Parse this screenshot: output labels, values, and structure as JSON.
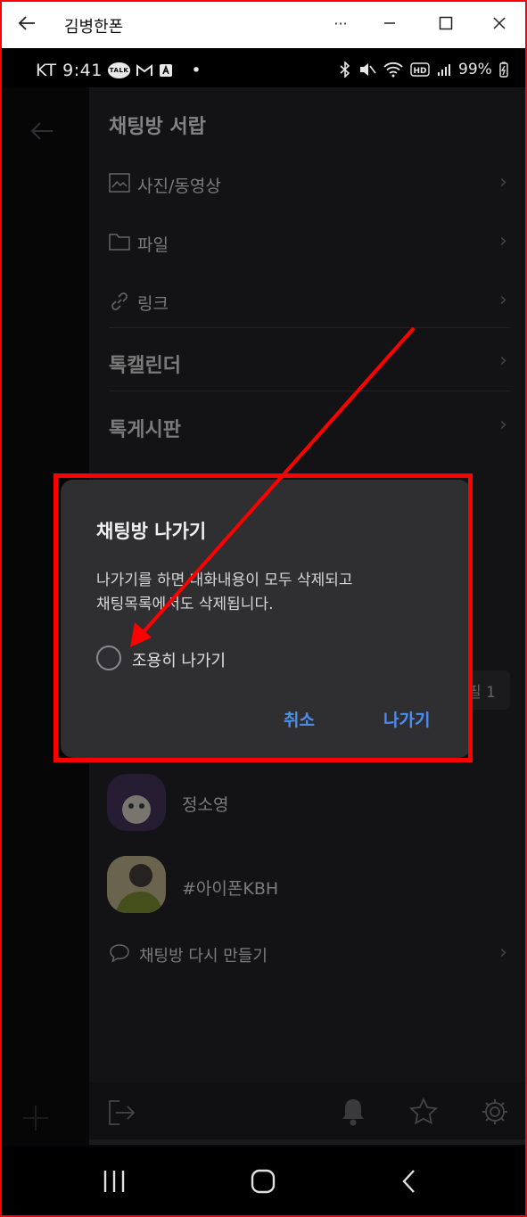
{
  "window": {
    "title": "김병한폰",
    "more_label": "···"
  },
  "statusbar": {
    "carrier_time": "KT 9:41",
    "dot": "•",
    "talk_badge": "TALK",
    "battery": "99%"
  },
  "drawer": {
    "title": "채팅방 서랍",
    "items": [
      {
        "label": "사진/동영상",
        "icon": "image-icon"
      },
      {
        "label": "파일",
        "icon": "folder-icon"
      },
      {
        "label": "링크",
        "icon": "link-icon"
      }
    ],
    "sections": [
      "톡캘린더",
      "톡게시판"
    ],
    "partial_badge": "필 1",
    "members": [
      {
        "name": "정소영",
        "avatar": "avatar-icon"
      },
      {
        "name": "#아이폰KBH",
        "avatar": "avatar-icon"
      }
    ],
    "recreate_label": "채팅방 다시 만들기"
  },
  "dialog": {
    "title": "채팅방 나가기",
    "body": "나가기를 하면 대화내용이 모두 삭제되고\n채팅목록에서도 삭제됩니다.",
    "checkbox_label": "조용히 나가기",
    "checkbox_checked": false,
    "cancel_label": "취소",
    "leave_label": "나가기"
  },
  "colors": {
    "annotation": "#ff0000",
    "accent": "#4b8ef0",
    "drawer_bg": "#1e1e21",
    "dialog_bg": "#2f2f31"
  }
}
